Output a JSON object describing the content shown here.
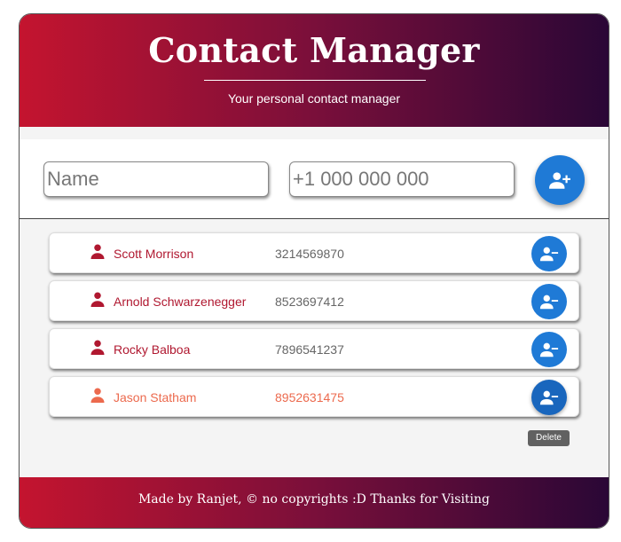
{
  "header": {
    "title": "Contact Manager",
    "subtitle": "Your personal contact manager"
  },
  "form": {
    "name_placeholder": "Name",
    "phone_placeholder": "+1 000 000 000",
    "add_button_icon": "person-add-icon"
  },
  "contacts": [
    {
      "name": "Scott Morrison",
      "phone": "3214569870"
    },
    {
      "name": "Arnold Schwarzenegger",
      "phone": "8523697412"
    },
    {
      "name": "Rocky Balboa",
      "phone": "7896541237"
    },
    {
      "name": "Jason Statham",
      "phone": "8952631475"
    }
  ],
  "tooltip": "Delete",
  "footer": "Made by Ranjet, © no copyrights :D Thanks for Visiting",
  "colors": {
    "gradient_start": "#c4142f",
    "gradient_end": "#2a0736",
    "accent_blue": "#1f7ad6",
    "name_color": "#b01830",
    "hover_color": "#ec6a4e"
  }
}
